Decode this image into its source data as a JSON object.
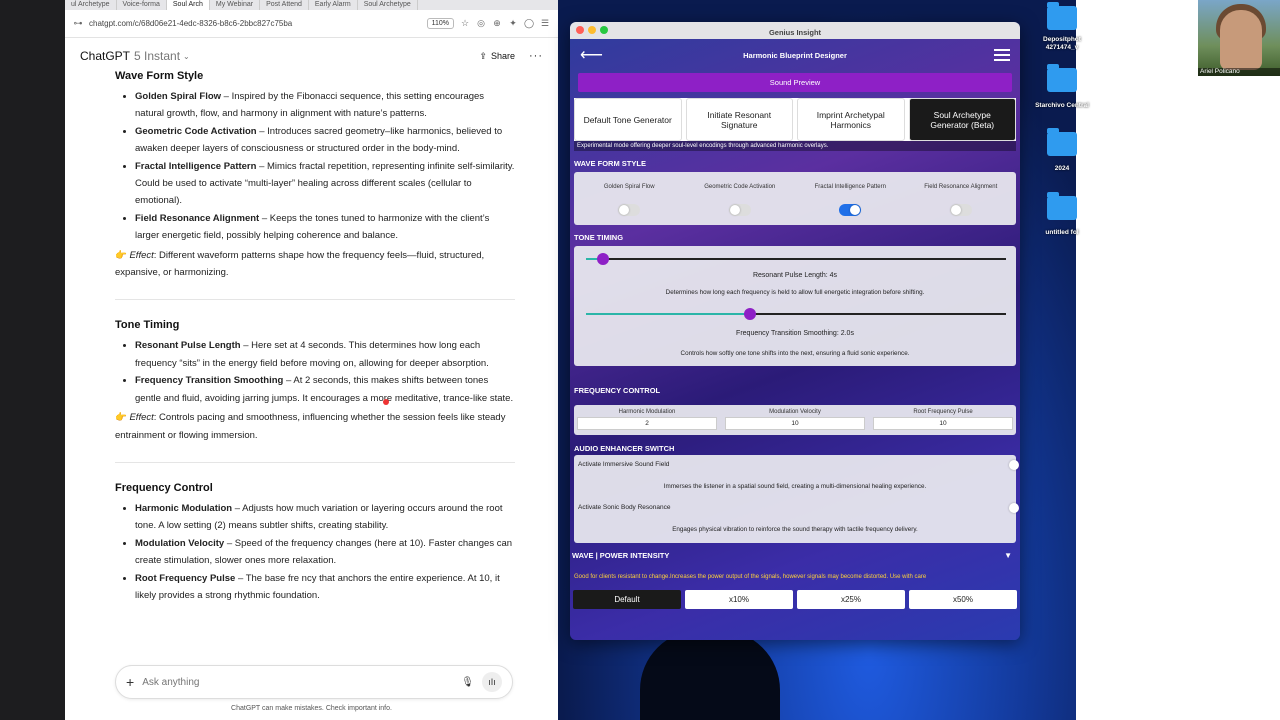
{
  "browser": {
    "tabs": [
      "ul Archetype",
      "Voice-forma",
      "Soul Arch",
      "My Webinar",
      "Post Attend",
      "Early Alarm",
      "Soul Archetype"
    ],
    "url": "chatgpt.com/c/68d06e21-4edc-8326-b8c6-2bbc827c75ba",
    "zoom": "110%"
  },
  "chat": {
    "app_title": "ChatGPT",
    "model": "5 Instant",
    "share_label": "Share",
    "sections": [
      {
        "heading": "Wave Form Style",
        "items": [
          {
            "term": "Golden Spiral Flow",
            "text": " – Inspired by the Fibonacci sequence, this setting encourages natural growth, flow, and harmony in alignment with nature’s patterns."
          },
          {
            "term": "Geometric Code Activation",
            "text": " – Introduces sacred geometry–like harmonics, believed to awaken deeper layers of consciousness or structured order in the body-mind."
          },
          {
            "term": "Fractal Intelligence Pattern",
            "text": " – Mimics fractal repetition, representing infinite self-similarity. Could be used to activate “multi-layer” healing across different scales (cellular to emotional)."
          },
          {
            "term": "Field Resonance Alignment",
            "text": " – Keeps the tones tuned to harmonize with the client’s larger energetic field, possibly helping coherence and balance."
          }
        ],
        "effect_label": "Effect",
        "effect_text": ": Different waveform patterns shape how the frequency feels—fluid, structured, expansive, or harmonizing."
      },
      {
        "heading": "Tone Timing",
        "items": [
          {
            "term": "Resonant Pulse Length",
            "text": " – Here set at 4 seconds. This determines how long each frequency “sits” in the energy field before moving on, allowing for deeper absorption."
          },
          {
            "term": "Frequency Transition Smoothing",
            "text": " – At 2 seconds, this makes shifts between tones gentle and fluid, avoiding jarring jumps. It encourages a more meditative, trance-like state."
          }
        ],
        "effect_label": "Effect",
        "effect_text": ": Controls pacing and smoothness, influencing whether the session feels like steady entrainment or flowing immersion."
      },
      {
        "heading": "Frequency Control",
        "items": [
          {
            "term": "Harmonic Modulation",
            "text": " – Adjusts how much variation or layering occurs around the root tone. A low setting (2) means subtler shifts, creating stability."
          },
          {
            "term": "Modulation Velocity",
            "text": " – Speed of the frequency changes (here at 10). Faster changes can create stimulation, slower ones more relaxation."
          },
          {
            "term": "Root Frequency Pulse",
            "text": " – The base fre    ncy that anchors the entire experience. At 10, it likely provides a strong rhythmic foundation."
          }
        ]
      }
    ],
    "composer_placeholder": "Ask anything",
    "disclaimer": "ChatGPT can make mistakes. Check important info."
  },
  "gi": {
    "window_title": "Genius Insight",
    "designer_title": "Harmonic Blueprint Designer",
    "sound_preview": "Sound Preview",
    "generators": [
      "Default Tone Generator",
      "Initiate Resonant Signature",
      "Imprint Archetypal Harmonics",
      "Soul Archetype Generator (Beta)"
    ],
    "selected_generator": "Soul Archetype Generator (Beta)",
    "generator_desc": "Experimental mode offering deeper soul-level encodings through advanced harmonic overlays.",
    "waveform_label": "WAVE FORM STYLE",
    "waveforms": [
      {
        "label": "Golden Spiral Flow",
        "on": false
      },
      {
        "label": "Geometric Code Activation",
        "on": false
      },
      {
        "label": "Fractal Intelligence Pattern",
        "on": true
      },
      {
        "label": "Field Resonance Alignment",
        "on": false
      }
    ],
    "tone_timing_label": "TONE TIMING",
    "pulse_label": "Resonant Pulse Length: 4s",
    "pulse_value_fraction": 0.04,
    "pulse_desc": "Determines how long each frequency is held to allow full energetic integration before shifting.",
    "smoothing_label": "Frequency Transition Smoothing: 2.0s",
    "smoothing_value_fraction": 0.39,
    "smoothing_desc": "Controls how softly one tone shifts into the next, ensuring a fluid sonic experience.",
    "frequency_label": "FREQUENCY CONTROL",
    "frequency_fields": [
      {
        "label": "Harmonic Modulation",
        "value": "2"
      },
      {
        "label": "Modulation Velocity",
        "value": "10"
      },
      {
        "label": "Root Frequency Pulse",
        "value": "10"
      }
    ],
    "audio_label": "AUDIO ENHANCER SWITCH",
    "immersive_label": "Activate Immersive Sound Field",
    "immersive_desc": "Immerses the listener in a spatial sound field, creating a multi-dimensional healing experience.",
    "sonic_label": "Activate Sonic Body Resonance",
    "sonic_desc": "Engages physical vibration to reinforce the sound therapy with tactile frequency delivery.",
    "power_label": "WAVE | POWER INTENSITY",
    "power_desc": "Good for clients resistant to change.Increases the power output of the signals, however signals may become distorted. Use with care",
    "intensity_options": [
      "Default",
      "x10%",
      "x25%",
      "x50%"
    ],
    "selected_intensity": "Default"
  },
  "desktop": {
    "icons": [
      "Depositphot 4271474_v",
      "Starchivo Central",
      "2024",
      "untitled fol"
    ],
    "webcam_name": "Ariel Policano"
  },
  "colors": {
    "accent_purple": "#8e20c6",
    "toggle_on": "#1f6fe8",
    "warning_text": "#ffd23a",
    "folder_blue": "#2f9bef"
  }
}
